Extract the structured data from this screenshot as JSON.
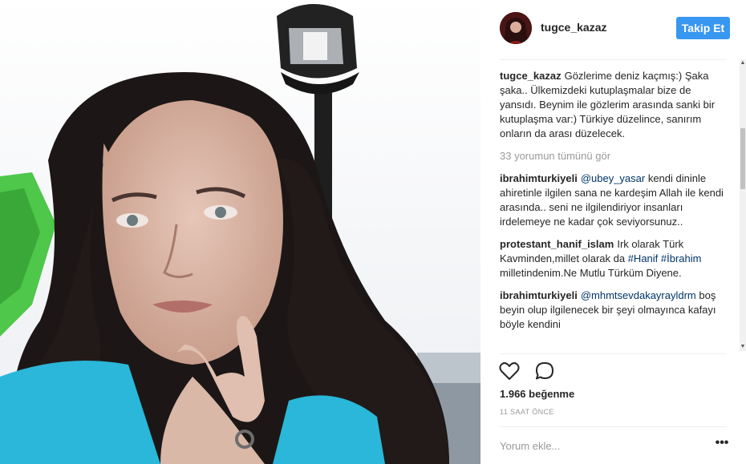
{
  "post": {
    "photo_alt": "",
    "photo_colors": {
      "sky": "#f5f5f7",
      "hair": "#1c1716",
      "skin": "#d9b8a8",
      "shirt": "#2ab7d9",
      "lamp": "#1b1b1b",
      "green": "#4ec74a"
    }
  },
  "header": {
    "username": "tugce_kazaz",
    "follow_label": "Takip Et"
  },
  "caption": {
    "user": "tugce_kazaz",
    "text": "Gözlerime deniz kaçmış:) Şaka şaka.. Ülkemizdeki kutuplaşmalar bize de yansıdı. Beynim ile gözlerim arasında sanki bir kutuplaşma var:) Türkiye düzelince, sanırım onların da arası düzelecek."
  },
  "view_all_comments": "33 yorumun tümünü gör",
  "comments": [
    {
      "user": "ibrahimturkiyeli",
      "mention": "@ubey_yasar",
      "text": " kendi dininle ahiretinle ilgilen sana ne kardeşim Allah ile kendi arasında.. seni ne ilgilendiriyor insanları irdelemeye ne kadar çok seviyorsunuz.."
    },
    {
      "user": "protestant_hanif_islam",
      "text_before": "Irk olarak Türk Kavminden,millet olarak da ",
      "hashtag1": "#Hanif",
      "hashtag2": "#İbrahim",
      "text_after": " milletindenim.Ne Mutlu Türküm Diyene."
    },
    {
      "user": "ibrahimturkiyeli",
      "mention": "@mhmtsevdakayrayldrm",
      "text": " boş beyin olup ilgilenecek bir şeyi olmayınca kafayı böyle kendini"
    }
  ],
  "actions": {
    "like_icon": "heart-icon",
    "comment_icon": "comment-bubble-icon"
  },
  "likes": "1.966 beğenme",
  "timestamp": "11 SAAT ÖNCE",
  "comment_box": {
    "placeholder": "Yorum ekle...",
    "more_label": "•••"
  },
  "colors": {
    "accent": "#3897f0",
    "link": "#003569",
    "muted": "#999999",
    "text": "#262626"
  }
}
